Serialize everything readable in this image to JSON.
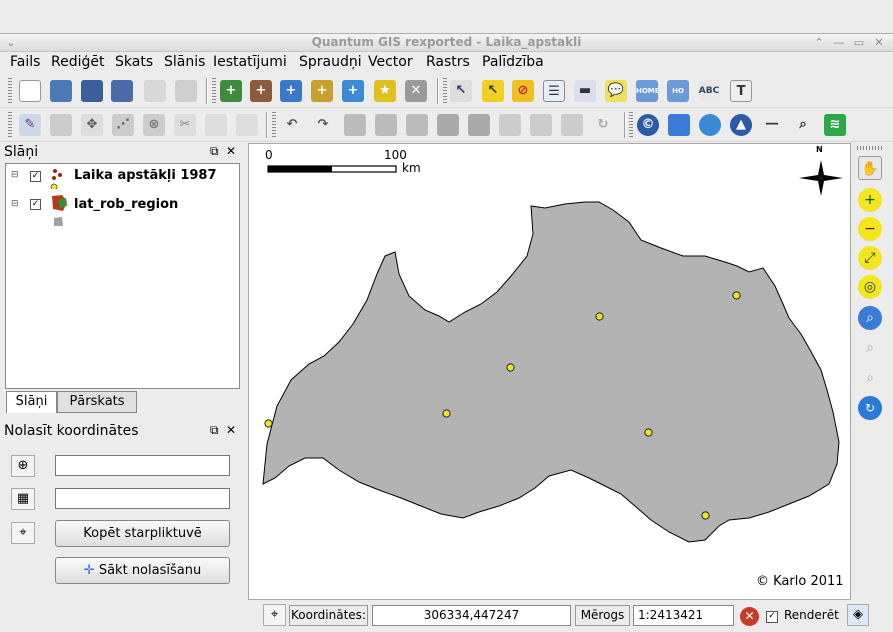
{
  "window": {
    "title": "Quantum GIS rexported - Laika_apstakli"
  },
  "menu": [
    "Fails",
    "Rediģēt",
    "Skats",
    "Slānis",
    "Iestatījumi",
    "Spraudņi",
    "Vector",
    "Rastrs",
    "Palīdzība"
  ],
  "layers_panel": {
    "title": "Slāņi",
    "items": [
      {
        "label": "Laika apstākļi 1987",
        "checked": true,
        "icon": "point-layer-icon"
      },
      {
        "label": "lat_rob_region",
        "checked": true,
        "icon": "polygon-layer-icon"
      }
    ],
    "tabs": [
      "Slāņi",
      "Pārskats"
    ]
  },
  "coords_panel": {
    "title": "Nolasīt koordinātes",
    "field1": "",
    "field2": "",
    "copy_button": "Kopēt starpliktuvē",
    "start_button": "Sākt nolasīšanu"
  },
  "map": {
    "scalebar": {
      "start": "0",
      "end": "100",
      "unit": "km"
    },
    "north": "N",
    "copyright": "© Karlo 2011",
    "polygon_color": "#b3b3b3",
    "point_color": "#f3e520"
  },
  "status": {
    "coords_label": "Koordinātes:",
    "coords_value": "306334,447247",
    "scale_label": "Mērogs",
    "scale_value": "1:2413421",
    "render_label": "Renderēt",
    "render_checked": true
  }
}
